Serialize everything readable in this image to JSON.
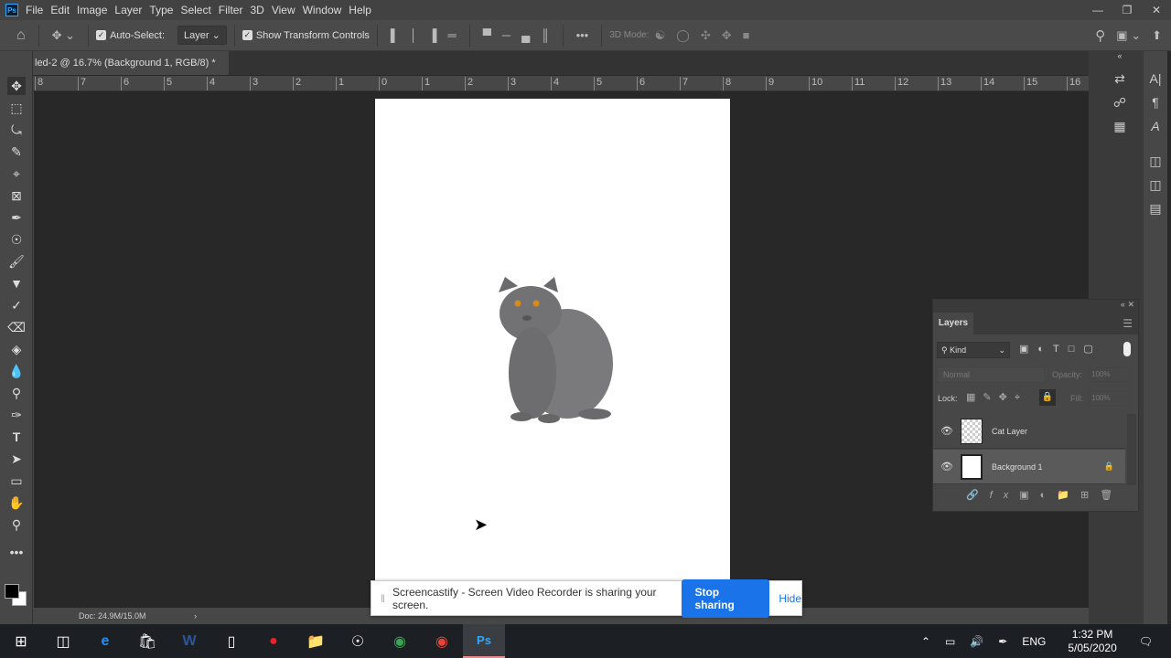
{
  "menu": {
    "items": [
      "File",
      "Edit",
      "Image",
      "Layer",
      "Type",
      "Select",
      "Filter",
      "3D",
      "View",
      "Window",
      "Help"
    ]
  },
  "options": {
    "auto_select_label": "Auto-Select:",
    "auto_select_value": "Layer",
    "show_transform_label": "Show Transform Controls",
    "mode_3d_label": "3D Mode:"
  },
  "document": {
    "tab_title": "led-2 @ 16.7% (Background 1, RGB/8) *",
    "status": "Doc: 24.9M/15.0M"
  },
  "ruler": {
    "labels": [
      "8",
      "7",
      "6",
      "5",
      "4",
      "3",
      "2",
      "1",
      "0",
      "1",
      "2",
      "3",
      "4",
      "5",
      "6",
      "7",
      "8",
      "9",
      "10",
      "11",
      "12",
      "13",
      "14",
      "15",
      "16"
    ]
  },
  "layers_panel": {
    "title": "Layers",
    "filter_kind": "Kind",
    "blend_mode": "Normal",
    "opacity_label": "Opacity:",
    "opacity_value": "100%",
    "lock_label": "Lock:",
    "fill_label": "Fill:",
    "fill_value": "100%",
    "layers": [
      {
        "name": "Cat Layer",
        "visible": true,
        "locked": false
      },
      {
        "name": "Background 1",
        "visible": true,
        "locked": true,
        "selected": true
      }
    ]
  },
  "screencastify": {
    "message": "Screencastify - Screen Video Recorder is sharing your screen.",
    "stop_label": "Stop sharing",
    "hide_label": "Hide"
  },
  "taskbar": {
    "language": "ENG",
    "time": "1:32 PM",
    "date": "5/05/2020"
  }
}
